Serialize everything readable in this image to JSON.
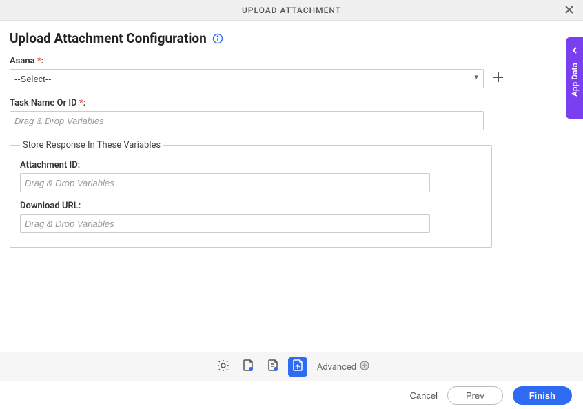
{
  "header": {
    "title": "UPLOAD ATTACHMENT"
  },
  "page": {
    "title": "Upload Attachment Configuration"
  },
  "fields": {
    "asana": {
      "label": "Asana ",
      "selected": "--Select--"
    },
    "task": {
      "label": "Task Name Or ID ",
      "placeholder": "Drag & Drop Variables"
    }
  },
  "group": {
    "legend": "Store Response In These Variables",
    "attachment": {
      "label": "Attachment ID:",
      "placeholder": "Drag & Drop Variables"
    },
    "download": {
      "label": "Download URL:",
      "placeholder": "Drag & Drop Variables"
    }
  },
  "sidetab": {
    "label": "App Data"
  },
  "toolbar": {
    "advanced": "Advanced"
  },
  "footer": {
    "cancel": "Cancel",
    "prev": "Prev",
    "finish": "Finish"
  }
}
